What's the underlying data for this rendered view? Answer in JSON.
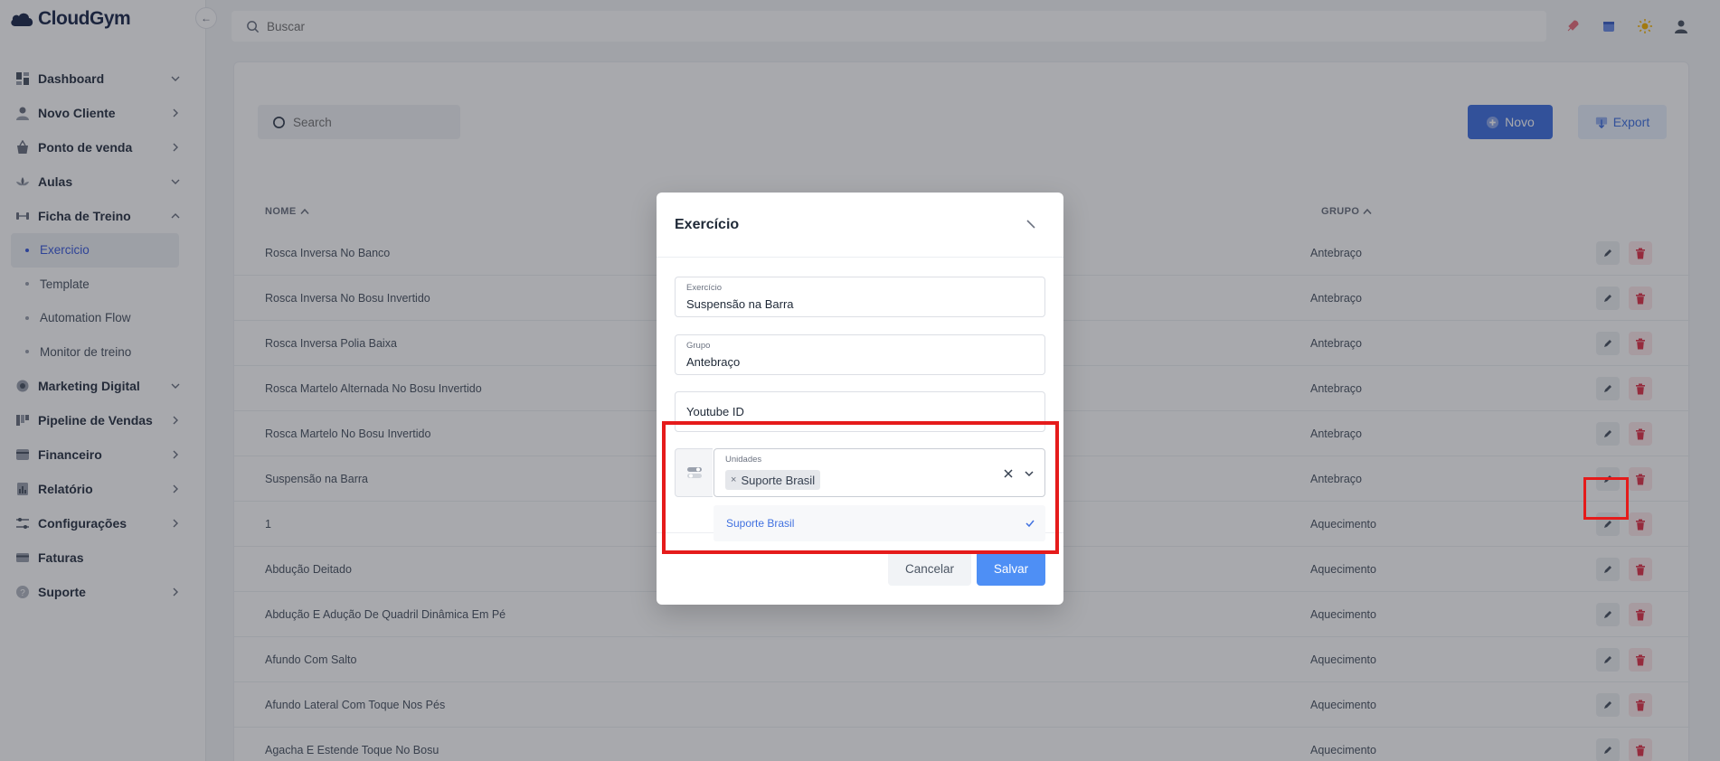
{
  "app": {
    "brand": "CloudGym"
  },
  "topbar": {
    "search_placeholder": "Buscar"
  },
  "sidebar": {
    "items": [
      {
        "label": "Dashboard",
        "icon": "dashboard-icon",
        "chevron": "down"
      },
      {
        "label": "Novo Cliente",
        "icon": "user-icon",
        "chevron": "right"
      },
      {
        "label": "Ponto de venda",
        "icon": "basket-icon",
        "chevron": "right"
      },
      {
        "label": "Aulas",
        "icon": "lotus-icon",
        "chevron": "down"
      },
      {
        "label": "Ficha de Treino",
        "icon": "dumbbell-icon",
        "chevron": "up"
      },
      {
        "label": "Marketing Digital",
        "icon": "camera-icon",
        "chevron": "down"
      },
      {
        "label": "Pipeline de Vendas",
        "icon": "pipeline-icon",
        "chevron": "right"
      },
      {
        "label": "Financeiro",
        "icon": "finance-icon",
        "chevron": "right"
      },
      {
        "label": "Relatório",
        "icon": "report-icon",
        "chevron": "right"
      },
      {
        "label": "Configurações",
        "icon": "settings-icon",
        "chevron": "right"
      },
      {
        "label": "Faturas",
        "icon": "card-icon",
        "chevron": ""
      },
      {
        "label": "Suporte",
        "icon": "help-icon",
        "chevron": "right"
      }
    ],
    "subitems": [
      {
        "label": "Exercicio",
        "active": true
      },
      {
        "label": "Template",
        "active": false
      },
      {
        "label": "Automation Flow",
        "active": false
      },
      {
        "label": "Monitor de treino",
        "active": false
      }
    ]
  },
  "list": {
    "search_placeholder": "Search",
    "new_label": "Novo",
    "export_label": "Export",
    "col_nome": "NOME",
    "col_grupo": "GRUPO",
    "rows": [
      {
        "nome": "Rosca Inversa No Banco",
        "grupo": "Antebraço"
      },
      {
        "nome": "Rosca Inversa No Bosu Invertido",
        "grupo": "Antebraço"
      },
      {
        "nome": "Rosca Inversa Polia Baixa",
        "grupo": "Antebraço"
      },
      {
        "nome": "Rosca Martelo Alternada No Bosu Invertido",
        "grupo": "Antebraço"
      },
      {
        "nome": "Rosca Martelo No Bosu Invertido",
        "grupo": "Antebraço"
      },
      {
        "nome": "Suspensão na Barra",
        "grupo": "Antebraço"
      },
      {
        "nome": "1",
        "grupo": "Aquecimento"
      },
      {
        "nome": "Abdução Deitado",
        "grupo": "Aquecimento"
      },
      {
        "nome": "Abdução E Adução De Quadril Dinâmica Em Pé",
        "grupo": "Aquecimento"
      },
      {
        "nome": "Afundo Com Salto",
        "grupo": "Aquecimento"
      },
      {
        "nome": "Afundo Lateral Com Toque Nos Pés",
        "grupo": "Aquecimento"
      },
      {
        "nome": "Agacha E Estende Toque No Bosu",
        "grupo": "Aquecimento"
      }
    ]
  },
  "modal": {
    "title": "Exercício",
    "exercicio_label": "Exercício",
    "exercicio_value": "Suspensão na Barra",
    "grupo_label": "Grupo",
    "grupo_value": "Antebraço",
    "youtube_placeholder": "Youtube ID",
    "unidades_label": "Unidades",
    "unidades_selected": "Suporte Brasil",
    "dropdown_option": "Suporte Brasil",
    "cancel_label": "Cancelar",
    "save_label": "Salvar"
  },
  "colors": {
    "accent": "#4171e0",
    "highlight": "#e51b1b",
    "danger": "#e0344b"
  }
}
